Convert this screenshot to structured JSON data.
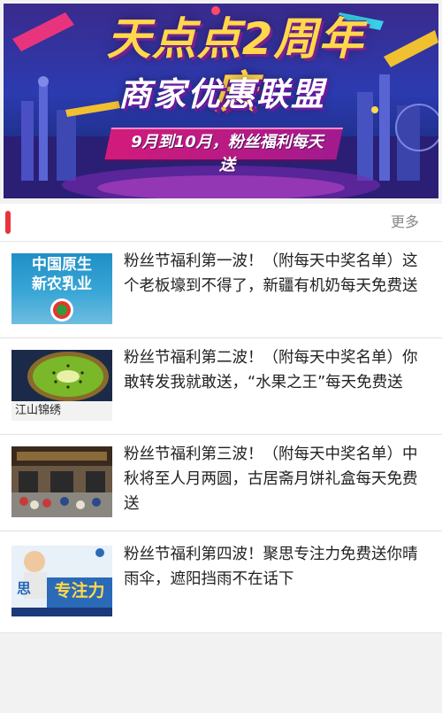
{
  "banner": {
    "title": "天点点2周年庆",
    "subtitle": "商家优惠联盟",
    "ribbon": "9月到10月，粉丝福利每天送"
  },
  "section": {
    "more_label": "更多"
  },
  "articles": [
    {
      "title": "粉丝节福利第一波！（附每天中奖名单）这个老板壕到不得了，新疆有机奶每天免费送",
      "thumb_text_1": "中国原生",
      "thumb_text_2": "新农乳业"
    },
    {
      "title": "粉丝节福利第二波！（附每天中奖名单）你敢转发我就敢送，“水果之王”每天免费送",
      "thumb_text_1": "江山锦绣"
    },
    {
      "title": "粉丝节福利第三波！（附每天中奖名单）中秋将至人月两圆，古居斋月饼礼盒每天免费送"
    },
    {
      "title": "粉丝节福利第四波！聚思专注力免费送你晴雨伞，遮阳挡雨不在话下",
      "thumb_text_1": "思",
      "thumb_text_2": "专注力"
    }
  ],
  "colors": {
    "accent_marker": "#e8343c",
    "more_text": "#888888",
    "banner_gold": "#ffd94a"
  }
}
